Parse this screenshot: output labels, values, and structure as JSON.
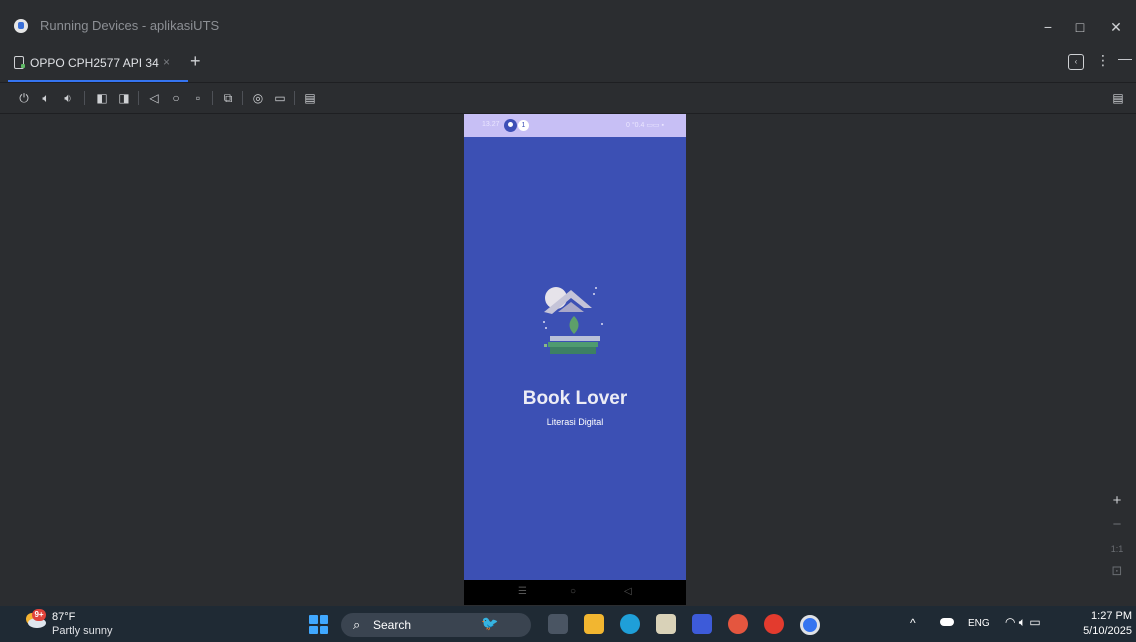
{
  "window": {
    "title": "Running Devices - aplikasiUTS",
    "minimize": "−",
    "maximize": "□",
    "close": "✕"
  },
  "tabs": {
    "device_tab_label": "OPPO CPH2577 API 34",
    "close_glyph": "×",
    "add_glyph": "+"
  },
  "toolbar": {
    "icons": [
      "power-icon",
      "volume-up-icon",
      "volume-down-icon",
      "rotate-left-icon",
      "rotate-right-icon",
      "back-icon",
      "home-icon",
      "overview-icon",
      "app-icon",
      "screenshot-icon",
      "screen-record-icon",
      "display-settings-icon",
      "device-settings-icon"
    ]
  },
  "phone": {
    "status_time": "13.27",
    "status_badge_count": "1",
    "status_right": "0 °0.4 ▭▭ ▪",
    "app_title": "Book Lover",
    "app_subtitle": "Literasi Digital",
    "nav": {
      "menu": "☰",
      "home": "○",
      "back": "◁"
    }
  },
  "zoom": {
    "zoom_in": "+",
    "zoom_out": "−",
    "actual_size": "1:1",
    "fit_screen": "⊡"
  },
  "taskbar": {
    "weather_badge": "9+",
    "weather_temp": "87°F",
    "weather_desc": "Partly sunny",
    "search_label": "Search",
    "tray_lang": "ENG",
    "time": "1:27 PM",
    "date": "5/10/2025"
  },
  "colors": {
    "ide_bg": "#2b2d30",
    "accent": "#3574f0",
    "splash_bg": "#3c50b4",
    "status_bar": "#c7bff5",
    "taskbar_bg": "#1f2a34"
  }
}
